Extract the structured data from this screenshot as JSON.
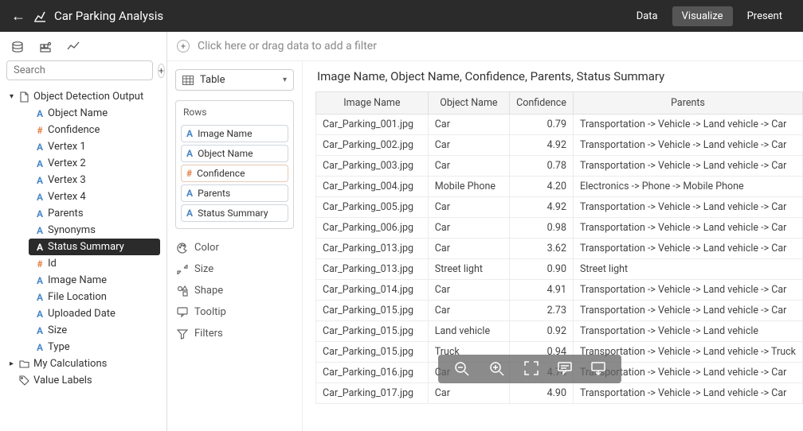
{
  "header": {
    "title": "Car Parking Analysis",
    "tabs": {
      "data": "Data",
      "visualize": "Visualize",
      "present": "Present"
    }
  },
  "search_placeholder": "Search",
  "filter_hint": "Click here or drag data to add a filter",
  "viz_type": "Table",
  "shelves": {
    "rows": "Rows",
    "color": "Color",
    "size": "Size",
    "shape": "Shape",
    "tooltip": "Tooltip",
    "filters": "Filters"
  },
  "pills": {
    "image": "Image Name",
    "object": "Object Name",
    "confidence": "Confidence",
    "parents": "Parents",
    "status": "Status Summary"
  },
  "tree": {
    "root": "Object Detection Output",
    "children": [
      "Object Name",
      "Confidence",
      "Vertex 1",
      "Vertex 2",
      "Vertex 3",
      "Vertex 4",
      "Parents",
      "Synonyms",
      "Status Summary",
      "Id",
      "Image Name",
      "File Location",
      "Uploaded Date",
      "Size",
      "Type"
    ],
    "selected": "Status Summary",
    "numeric": [
      "Confidence",
      "Id"
    ],
    "folders": {
      "calc": "My Calculations",
      "labels": "Value Labels"
    }
  },
  "canvas_title": "Image Name, Object Name, Confidence, Parents, Status Summary",
  "columns": {
    "image": "Image Name",
    "object": "Object Name",
    "confidence": "Confidence",
    "parents": "Parents"
  },
  "rows": [
    {
      "img": "Car_Parking_001.jpg",
      "obj": "Car",
      "conf": "0.79",
      "par": "Transportation -> Vehicle -> Land vehicle -> Car"
    },
    {
      "img": "Car_Parking_002.jpg",
      "obj": "Car",
      "conf": "4.92",
      "par": "Transportation -> Vehicle -> Land vehicle -> Car"
    },
    {
      "img": "Car_Parking_003.jpg",
      "obj": "Car",
      "conf": "0.78",
      "par": "Transportation -> Vehicle -> Land vehicle -> Car"
    },
    {
      "img": "Car_Parking_004.jpg",
      "obj": "Mobile Phone",
      "conf": "4.20",
      "par": "Electronics -> Phone -> Mobile Phone"
    },
    {
      "img": "Car_Parking_005.jpg",
      "obj": "Car",
      "conf": "4.92",
      "par": "Transportation -> Vehicle -> Land vehicle -> Car"
    },
    {
      "img": "Car_Parking_006.jpg",
      "obj": "Car",
      "conf": "0.98",
      "par": "Transportation -> Vehicle -> Land vehicle -> Car"
    },
    {
      "img": "Car_Parking_013.jpg",
      "obj": "Car",
      "conf": "3.62",
      "par": "Transportation -> Vehicle -> Land vehicle -> Car"
    },
    {
      "img": "Car_Parking_013.jpg",
      "obj": "Street light",
      "conf": "0.90",
      "par": "Street light"
    },
    {
      "img": "Car_Parking_014.jpg",
      "obj": "Car",
      "conf": "4.91",
      "par": "Transportation -> Vehicle -> Land vehicle -> Car"
    },
    {
      "img": "Car_Parking_015.jpg",
      "obj": "Car",
      "conf": "2.73",
      "par": "Transportation -> Vehicle -> Land vehicle -> Car"
    },
    {
      "img": "Car_Parking_015.jpg",
      "obj": "Land vehicle",
      "conf": "0.92",
      "par": "Transportation -> Vehicle -> Land vehicle"
    },
    {
      "img": "Car_Parking_015.jpg",
      "obj": "Truck",
      "conf": "0.94",
      "par": "Transportation -> Vehicle -> Land vehicle -> Truck"
    },
    {
      "img": "Car_Parking_016.jpg",
      "obj": "Car",
      "conf": "4.74",
      "par": "Transportation -> Vehicle -> Land vehicle -> Car"
    },
    {
      "img": "Car_Parking_017.jpg",
      "obj": "Car",
      "conf": "4.90",
      "par": "Transportation -> Vehicle -> Land vehicle -> Car"
    }
  ]
}
